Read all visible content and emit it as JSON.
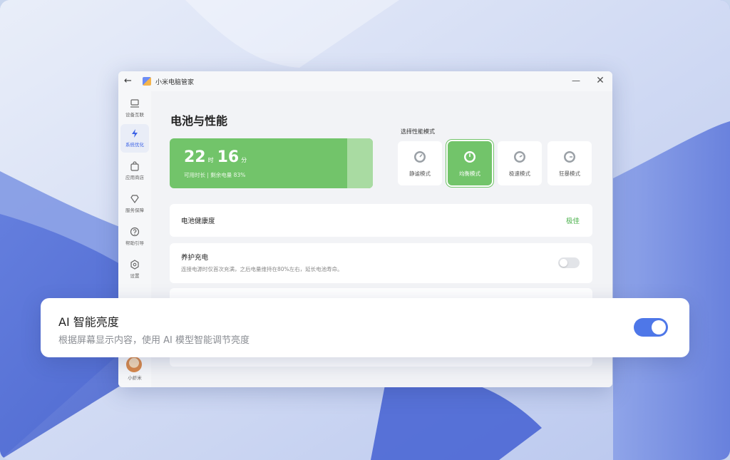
{
  "window": {
    "title": "小米电脑管家",
    "back_glyph": "←",
    "minimize_glyph": "—",
    "close_glyph": "✕"
  },
  "sidebar": {
    "items": [
      {
        "label": "设备互联",
        "icon": "device-connect-icon"
      },
      {
        "label": "系统优化",
        "icon": "lightning-icon"
      },
      {
        "label": "应用商店",
        "icon": "store-bag-icon"
      },
      {
        "label": "服务保障",
        "icon": "diamond-icon"
      },
      {
        "label": "帮助引导",
        "icon": "help-icon"
      },
      {
        "label": "设置",
        "icon": "settings-icon"
      }
    ],
    "user_label": "小虾米"
  },
  "main": {
    "page_title": "电池与性能",
    "battery": {
      "hours": "22",
      "hours_unit": "时",
      "minutes": "16",
      "minutes_unit": "分",
      "subtitle": "可用时长 | 剩余电量 83%",
      "level_percent": 83
    },
    "performance": {
      "label": "选择性能模式",
      "modes": [
        {
          "name": "静谧模式",
          "active": false
        },
        {
          "name": "均衡模式",
          "active": true
        },
        {
          "name": "极速模式",
          "active": false
        },
        {
          "name": "狂暴模式",
          "active": false
        }
      ]
    },
    "health": {
      "title": "电池健康度",
      "value": "极佳"
    },
    "care_charge": {
      "title": "养护充电",
      "description": "连接电源时仅首次充满，之后电量维持在80%左右，延长电池寿命。",
      "enabled": false
    }
  },
  "overlay": {
    "title": "AI 智能亮度",
    "description": "根据屏幕显示内容，使用 AI 模型智能调节亮度",
    "enabled": true
  },
  "colors": {
    "accent_green": "#72c46a",
    "accent_blue": "#4e77e8",
    "health_green": "#49b04a"
  }
}
